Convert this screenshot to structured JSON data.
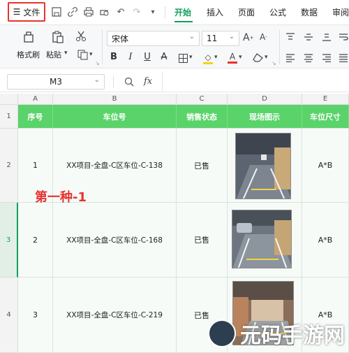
{
  "topbar": {
    "file_label": "文件",
    "tabs": [
      "开始",
      "插入",
      "页面",
      "公式",
      "数据",
      "审阅"
    ],
    "active_tab": "开始"
  },
  "toolbar": {
    "format_painter": "格式刷",
    "paste": "粘贴",
    "font_name": "宋体",
    "font_size": "11"
  },
  "formula_bar": {
    "cell_ref": "M3",
    "fx": "fx"
  },
  "sheet": {
    "columns": [
      "A",
      "B",
      "C",
      "D",
      "E"
    ],
    "row_numbers": [
      "1",
      "2",
      "3",
      "4"
    ],
    "headers": [
      "序号",
      "车位号",
      "销售状态",
      "现场图示",
      "车位尺寸"
    ],
    "rows": [
      {
        "no": "1",
        "slot": "XX项目-全盘-C区车位-C-138",
        "status": "已售",
        "size": "A*B"
      },
      {
        "no": "2",
        "slot": "XX项目-全盘-C区车位-C-168",
        "status": "已售",
        "size": "A*B"
      },
      {
        "no": "3",
        "slot": "XX项目-全盘-C区车位-C-219",
        "status": "已售",
        "size": "A*B"
      }
    ]
  },
  "annotation": "第一种-1",
  "watermark": "元码手游网"
}
